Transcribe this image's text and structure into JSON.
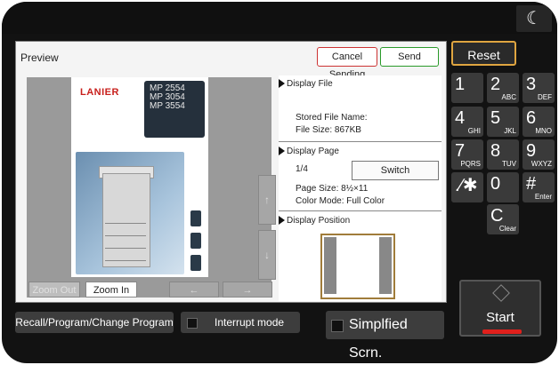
{
  "panel": {
    "title": "Preview",
    "cancel_label": "Cancel Sending",
    "send_label": "Send"
  },
  "document": {
    "brand": "LANIER",
    "models": [
      "MP 2554",
      "MP 3054",
      "MP 3554"
    ]
  },
  "preview_controls": {
    "zoom_out": "Zoom Out",
    "zoom_in": "Zoom In",
    "prev_icon": "←",
    "next_icon": "→",
    "scroll_up_icon": "↑",
    "scroll_down_icon": "↓"
  },
  "info": {
    "display_file_title": "Display File",
    "stored_file_name": "Stored File Name:",
    "file_size": "File Size: 867KB",
    "display_page_title": "Display Page",
    "page_count": "1/4",
    "switch_label": "Switch",
    "page_size": "Page Size: 8½×11",
    "color_mode": "Color Mode: Full Color",
    "display_position_title": "Display Position"
  },
  "keypad": {
    "reset_label": "Reset",
    "keys": [
      {
        "main": "1",
        "sub": ""
      },
      {
        "main": "2",
        "sub": "ABC"
      },
      {
        "main": "3",
        "sub": "DEF"
      },
      {
        "main": "4",
        "sub": "GHI"
      },
      {
        "main": "5",
        "sub": "JKL"
      },
      {
        "main": "6",
        "sub": "MNO"
      },
      {
        "main": "7",
        "sub": "PQRS"
      },
      {
        "main": "8",
        "sub": "TUV"
      },
      {
        "main": "9",
        "sub": "WXYZ"
      },
      {
        "main": ".∕✱",
        "sub": ""
      },
      {
        "main": "0",
        "sub": ""
      },
      {
        "main": "#",
        "sub": "Enter"
      },
      {
        "main": "C",
        "sub": "Clear"
      }
    ],
    "start_label": "Start"
  },
  "bottom": {
    "recall_label": "Recall/Program/Change Program",
    "interrupt_label": "Interrupt mode",
    "simplified_label": "Simplfied Scrn."
  },
  "icons": {
    "moon": "☾"
  }
}
